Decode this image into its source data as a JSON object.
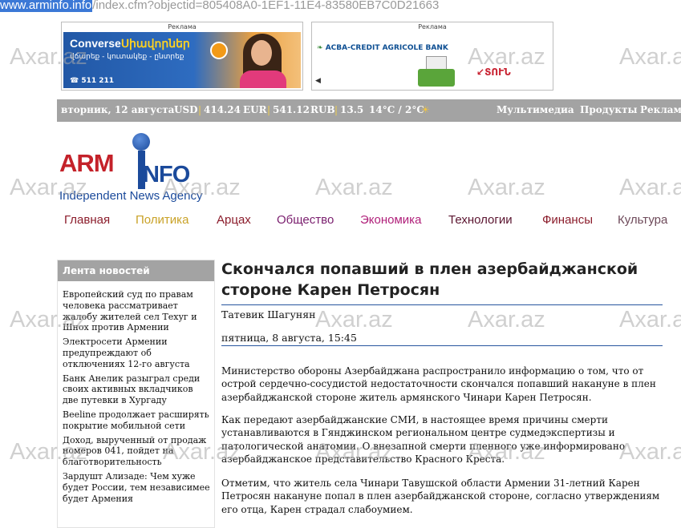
{
  "url": {
    "host": "www.arminfo.info",
    "path": "/index.cfm?objectid=805408A0-1EF1-11E4-83580EB7C0D21663"
  },
  "watermark": "Axar.az",
  "banners": {
    "left": {
      "label": "Реклама",
      "brand_a": "Converse",
      "brand_b": "Սիավորներ",
      "tagline": "վճարեք - կուտակեք - ընտրեք",
      "phone": "511 211"
    },
    "right": {
      "label": "Реклама",
      "bank": "ACBA-CREDIT AGRICOLE BANK",
      "slogan": "ՏՈՒՆ"
    }
  },
  "infobar": {
    "date": "вторник, 12 августа",
    "usd_label": "USD",
    "usd_value": "414.24",
    "eur_label": "EUR",
    "eur_value": "541.12",
    "rub_label": "RUB",
    "rub_value": "13.5",
    "weather": "14°C / 2°C",
    "sep": "|",
    "links": [
      "Мультимедиа",
      "Продукты",
      "Реклама"
    ]
  },
  "logo": {
    "arm": "ARM",
    "info": "INFO",
    "tagline": "Independent News Agency"
  },
  "nav": [
    {
      "label": "Главная",
      "color": "#8b1c2b"
    },
    {
      "label": "Политика",
      "color": "#c9a227"
    },
    {
      "label": "Арцах",
      "color": "#8b1c2b"
    },
    {
      "label": "Общество",
      "color": "#7a1e6e"
    },
    {
      "label": "Экономика",
      "color": "#b0207a"
    },
    {
      "label": "Технологии",
      "color": "#5b1530"
    },
    {
      "label": "Финансы",
      "color": "#8b1c2b"
    },
    {
      "label": "Культура",
      "color": "#6e4a5a"
    }
  ],
  "sidebar": {
    "title": "Лента новостей",
    "items": [
      "Европейский суд по правам человека рассматривает жалобу жителей сел Техуг и Шнох против Армении",
      "Электросети Армении предупреждают об отключениях 12-го августа",
      "Банк Анелик разыграл среди своих активных вкладчиков две путевки в Хургаду",
      "Beeline продолжает расширять покрытие мобильной сети",
      "Доход, вырученный от продаж номеров 041, пойдет на благотворительность",
      "Зардушт Ализаде: Чем хуже будет России, тем независимее будет Армения"
    ]
  },
  "article": {
    "title": "Скончался попавший в плен азербайджанской стороне Карен Петросян",
    "author": "Татевик Шагунян",
    "date": "пятница, 8 августа, 15:45",
    "paragraphs": [
      "Министерство обороны Азербайджана распространило информацию о том, что от острой сердечно-сосудистой недостаточности скончался попавший накануне в плен азербайджанской стороне житель армянского Чинари Карен Петросян.",
      "Как передают азербайджанские СМИ, в настоящее время причины смерти устанавливаются в Гянджинском региональном центре судмедэкспертизы и патологической анатомии. О внезапной смерти пленного уже информировано азербайджанское представительство Красного Креста.",
      "Отметим, что житель села Чинари Тавушской области Армении 31-летний Карен Петросян накануне попал в плен азербайджанской стороне, согласно утверждениям его отца, Карен страдал слабоумием."
    ]
  }
}
